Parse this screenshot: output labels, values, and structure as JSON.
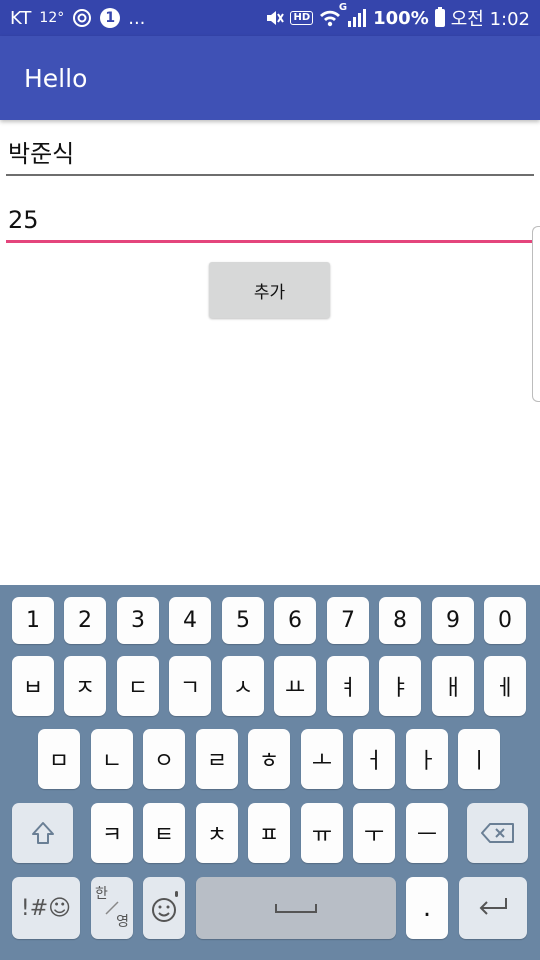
{
  "status_bar": {
    "carrier": "KT",
    "temperature": "12°",
    "notification_count": "1",
    "more": "...",
    "hd_label": "HD",
    "network_type": "G",
    "battery": "100%",
    "time": "오전 1:02",
    "icons": [
      "target-icon",
      "mute-icon",
      "wifi-icon",
      "signal-icon",
      "battery-icon"
    ]
  },
  "app_bar": {
    "title": "Hello"
  },
  "form": {
    "name_value": "박준식",
    "age_value": "25",
    "add_label": "추가"
  },
  "keyboard": {
    "row_numbers": [
      "1",
      "2",
      "3",
      "4",
      "5",
      "6",
      "7",
      "8",
      "9",
      "0"
    ],
    "row1": [
      "ㅂ",
      "ㅈ",
      "ㄷ",
      "ㄱ",
      "ㅅ",
      "ㅛ",
      "ㅕ",
      "ㅑ",
      "ㅐ",
      "ㅔ"
    ],
    "row2": [
      "ㅁ",
      "ㄴ",
      "ㅇ",
      "ㄹ",
      "ㅎ",
      "ㅗ",
      "ㅓ",
      "ㅏ",
      "ㅣ"
    ],
    "row3": [
      "ㅋ",
      "ㅌ",
      "ㅊ",
      "ㅍ",
      "ㅠ",
      "ㅜ",
      "ㅡ"
    ],
    "symbols_label": "!#☺",
    "han_label": "한",
    "eng_label": "영",
    "period_label": ".",
    "colors": {
      "background": "#6a86a3",
      "key": "#fdfdfd",
      "function_key": "#e3e8ee",
      "space_key": "#b8bec6"
    }
  },
  "colors": {
    "status_bar": "#3545ac",
    "app_bar": "#3f51b5",
    "accent": "#e4457c"
  }
}
